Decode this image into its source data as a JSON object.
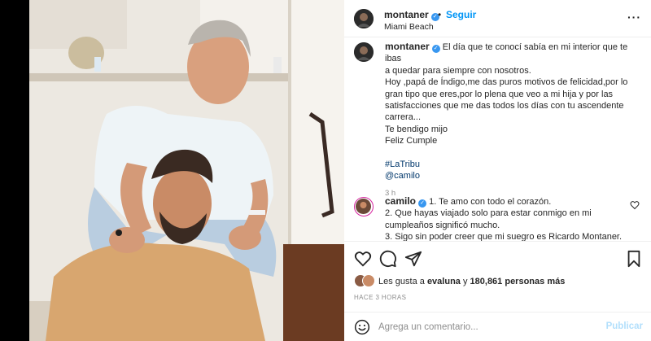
{
  "header": {
    "username": "montaner",
    "separator": "•",
    "follow_label": "Seguir",
    "location": "Miami Beach",
    "more_icon": "ellipsis-icon",
    "more_label": "···"
  },
  "caption": {
    "username": "montaner",
    "lines": [
      "El día que te conocí sabía en mi interior que te ibas",
      "a quedar para siempre con nosotros.",
      "Hoy ,papá de Índigo,me das puros motivos de felicidad,por lo",
      "gran tipo que eres,por lo plena que veo a mi hija y por las",
      "satisfacciones que me das todos los días con tu ascendente",
      "carrera...",
      "Te bendigo mijo",
      "Feliz Cumple",
      "",
      "#LaTribu",
      "@camilo"
    ],
    "time": "3 h"
  },
  "comment": {
    "username": "camilo",
    "lines": [
      "1. Te amo con todo el corazón.",
      "2. Que hayas viajado solo para estar conmigo en mi",
      "cumpleaños significó mucho.",
      "3. Sigo sin poder creer que mi suegro es Ricardo Montaner."
    ]
  },
  "actions": {
    "like_icon": "heart-icon",
    "comment_icon": "comment-icon",
    "share_icon": "send-icon",
    "save_icon": "bookmark-icon"
  },
  "likes": {
    "prefix": "Les gusta a",
    "first_user": "evaluna",
    "connector": "y",
    "count": "180,861 personas más"
  },
  "timeago": "HACE 3 HORAS",
  "composer": {
    "placeholder": "Agrega un comentario...",
    "post_label": "Publicar"
  },
  "colors": {
    "accent": "#0095f6",
    "verified": "#3897f0",
    "muted": "#8e8e8e",
    "link": "#00376b"
  }
}
